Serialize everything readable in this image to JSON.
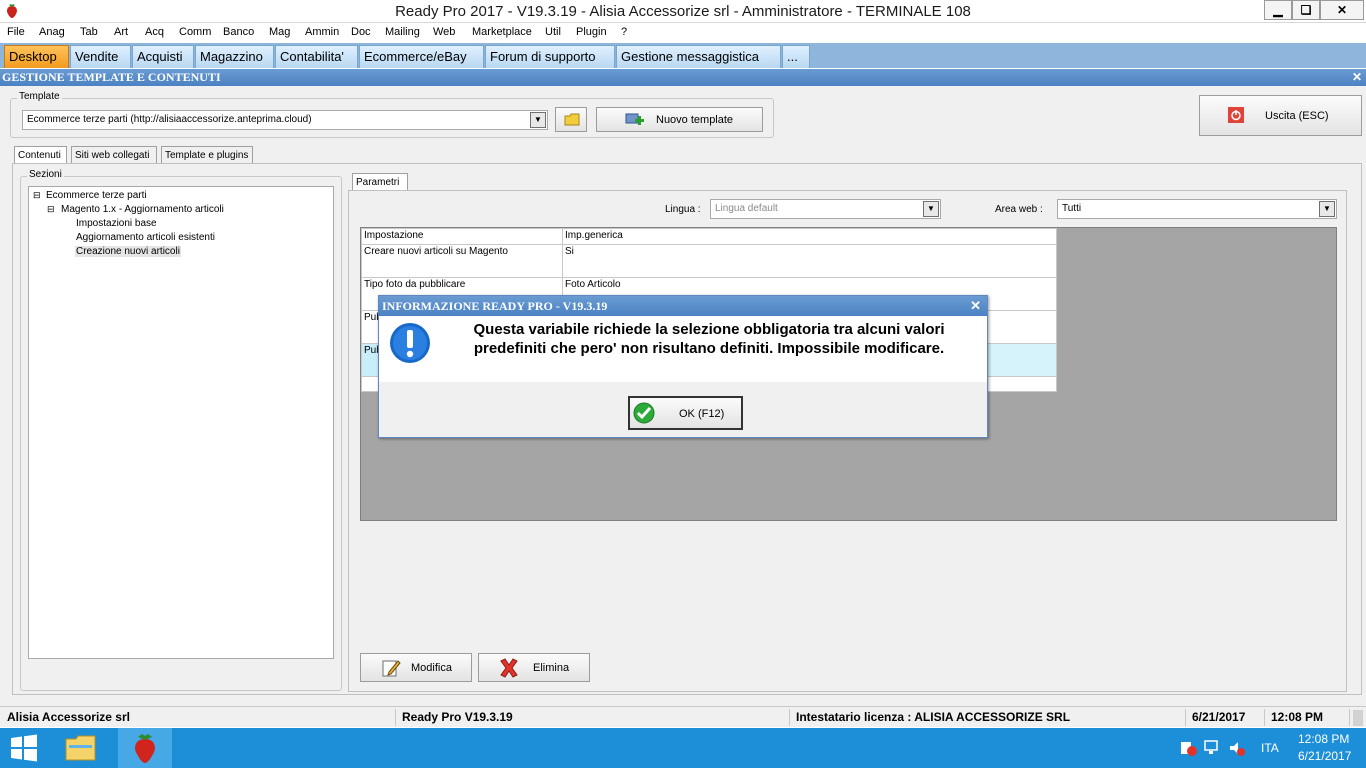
{
  "window": {
    "title": "Ready Pro 2017 - V19.3.19 - Alisia Accessorize srl - Amministratore - TERMINALE 108",
    "minimize": "▁",
    "restore": "❏",
    "close": "✕"
  },
  "menu": [
    "File",
    "Anag",
    "Tab",
    "Art",
    "Acq",
    "Comm",
    "Banco",
    "Mag",
    "Ammin",
    "Doc",
    "Mailing",
    "Web",
    "Marketplace",
    "Util",
    "Plugin",
    "?"
  ],
  "module_tabs": [
    "Desktop",
    "Vendite",
    "Acquisti",
    "Magazzino",
    "Contabilita'",
    "Ecommerce/eBay",
    "Forum di supporto",
    "Gestione messaggistica",
    "..."
  ],
  "section": {
    "title": "GESTIONE TEMPLATE E CONTENUTI",
    "close": "✕"
  },
  "template": {
    "label": "Template",
    "value": "Ecommerce terze parti (http://alisiaaccessorize.anteprima.cloud)",
    "new_button": "Nuovo template"
  },
  "exit_button": "Uscita (ESC)",
  "subtabs": [
    "Contenuti",
    "Siti web collegati",
    "Template e plugins"
  ],
  "sections_panel": {
    "label": "Sezioni",
    "nodes": [
      {
        "label": "Ecommerce terze parti",
        "expander": "⊟"
      },
      {
        "label": "Magento 1.x - Aggiornamento articoli",
        "expander": "⊟"
      },
      {
        "label": "Impostazioni base"
      },
      {
        "label": "Aggiornamento articoli esistenti"
      },
      {
        "label": "Creazione nuovi articoli"
      }
    ]
  },
  "params": {
    "tab": "Parametri",
    "lingua_label": "Lingua :",
    "lingua_value": "Lingua default",
    "area_label": "Area web :",
    "area_value": "Tutti",
    "headers": [
      "Impostazione",
      "Imp.generica"
    ],
    "rows": [
      {
        "name": "Creare nuovi articoli su Magento",
        "value": "Si"
      },
      {
        "name": "Tipo foto da pubblicare",
        "value": "Foto Articolo"
      },
      {
        "name": "Pub",
        "value": ""
      },
      {
        "name": "Pub",
        "value": ""
      }
    ]
  },
  "actions": {
    "modify": "Modifica",
    "delete": "Elimina"
  },
  "statusbar": {
    "company": "Alisia Accessorize srl",
    "version": "Ready Pro V19.3.19",
    "license": "Intestatario licenza : ALISIA ACCESSORIZE SRL",
    "date": "6/21/2017",
    "time": "12:08 PM"
  },
  "taskbar": {
    "lang": "ITA",
    "time": "12:08 PM",
    "date": "6/21/2017"
  },
  "modal": {
    "title": "INFORMAZIONE READY PRO - V19.3.19",
    "close": "✕",
    "message_line1": "Questa variabile richiede la selezione obbligatoria tra alcuni valori",
    "message_line2": "predefiniti che pero' non risultano definiti. Impossibile modificare.",
    "ok_button": "OK (F12)"
  }
}
